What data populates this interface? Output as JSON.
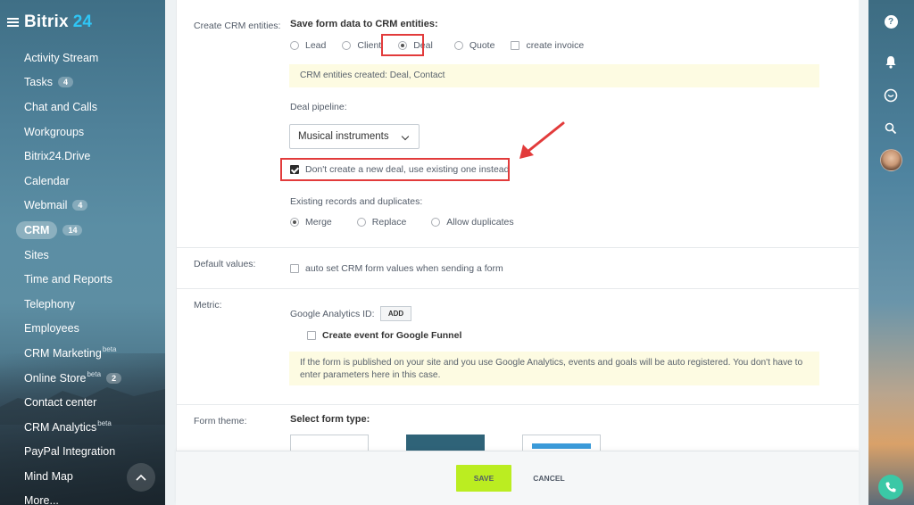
{
  "sidebar": {
    "logo_text": "Bitrix",
    "logo_num": "24",
    "items": [
      {
        "label": "Activity Stream"
      },
      {
        "label": "Tasks",
        "counter": "4"
      },
      {
        "label": "Chat and Calls"
      },
      {
        "label": "Workgroups"
      },
      {
        "label": "Bitrix24.Drive"
      },
      {
        "label": "Calendar"
      },
      {
        "label": "Webmail",
        "counter": "4"
      },
      {
        "label": "CRM",
        "counter": "14"
      },
      {
        "label": "Sites"
      },
      {
        "label": "Time and Reports"
      },
      {
        "label": "Telephony"
      },
      {
        "label": "Employees"
      },
      {
        "label": "CRM Marketing",
        "sup": "beta"
      },
      {
        "label": "Online Store",
        "sup": "beta",
        "counter": "2"
      },
      {
        "label": "Contact center"
      },
      {
        "label": "CRM Analytics",
        "sup": "beta"
      },
      {
        "label": "PayPal Integration"
      },
      {
        "label": "Mind Map"
      },
      {
        "label": "More..."
      }
    ]
  },
  "crm": {
    "section_label": "Create CRM entities:",
    "header": "Save form data to CRM entities:",
    "options": {
      "lead": "Lead",
      "client": "Client",
      "deal": "Deal",
      "quote": "Quote",
      "invoice": "create invoice"
    },
    "note": "CRM entities created: Deal, Contact",
    "pipeline_label": "Deal pipeline:",
    "pipeline_value": "Musical instruments",
    "existing_deal_label": "Don't create a new deal, use existing one instead",
    "duplicates_label": "Existing records and duplicates:",
    "duplicates": {
      "merge": "Merge",
      "replace": "Replace",
      "allow": "Allow duplicates"
    }
  },
  "defaults": {
    "section_label": "Default values:",
    "autoset_label": "auto set CRM form values when sending a form"
  },
  "metric": {
    "section_label": "Metric:",
    "ga_label": "Google Analytics ID:",
    "add_button": "ADD",
    "funnel_label": "Create event for Google Funnel",
    "note": "If the form is published on your site and you use Google Analytics, events and goals will be auto registered. You don't have to enter parameters here in this case."
  },
  "theme": {
    "section_label": "Form theme:",
    "header": "Select form type:"
  },
  "footer": {
    "save": "SAVE",
    "cancel": "CANCEL"
  },
  "rightrail": {
    "help": "?"
  },
  "colors": {
    "accent_green": "#bbed21",
    "highlight_red": "#e23b3b",
    "logo_blue": "#2fc6f6",
    "note_bg": "#fdfbe2"
  }
}
